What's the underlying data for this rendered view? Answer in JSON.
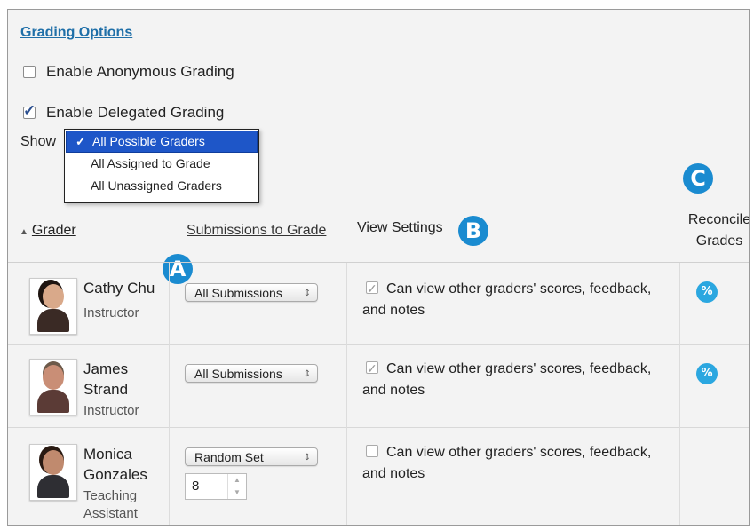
{
  "grading_options": {
    "title": "Grading Options",
    "anonymous": {
      "label": "Enable Anonymous Grading",
      "checked": false
    },
    "delegated": {
      "label": "Enable Delegated Grading",
      "checked": true
    }
  },
  "show": {
    "label": "Show",
    "check_mark": "✓",
    "options": [
      "All Possible Graders",
      "All Assigned to Grade",
      "All Unassigned Graders"
    ],
    "selected": "All Possible Graders"
  },
  "markers": {
    "a": "A",
    "b": "B",
    "c": "C"
  },
  "columns": {
    "grader": "Grader",
    "submissions": "Submissions to Grade",
    "view_settings": "View Settings",
    "reconcile_line1": "Reconcile",
    "reconcile_line2": "Grades"
  },
  "graders": [
    {
      "name": "Cathy Chu",
      "role": "Instructor",
      "submissions": "All Submissions",
      "view_text_1": "Can view other graders' scores, feedback,",
      "view_text_2": "and notes",
      "view_checked": true,
      "reconcile_icon": "⁒"
    },
    {
      "name": "James Strand",
      "role": "Instructor",
      "submissions": "All Submissions",
      "view_text_1": "Can view other graders' scores, feedback,",
      "view_text_2": "and notes",
      "view_checked": true,
      "reconcile_icon": "⁒"
    },
    {
      "name": "Monica Gonzales",
      "role": "Teaching Assistant",
      "submissions": "Random Set",
      "random_count": "8",
      "view_text_1": "Can view other graders' scores, feedback,",
      "view_text_2": "and notes",
      "view_checked": false
    }
  ],
  "select_arrows": "▲▼",
  "colors": {
    "accent": "#1a8bd0",
    "link": "#1f6fa8",
    "dropdown_selected": "#1e56c8",
    "reconcile": "#2ba7e0"
  }
}
